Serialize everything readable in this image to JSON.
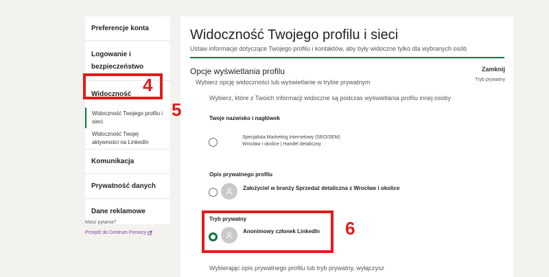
{
  "sidebar": {
    "items": [
      {
        "label": "Preferencje konta"
      },
      {
        "label": "Logowanie i bezpieczeństwo"
      },
      {
        "label": "Widoczność"
      },
      {
        "label": "Widoczność Twojego profilu i sieci"
      },
      {
        "label": "Widoczność Twojej aktywności na LinkedIn"
      },
      {
        "label": "Komunikacja"
      },
      {
        "label": "Prywatność danych"
      },
      {
        "label": "Dane reklamowe"
      }
    ],
    "help_question": "Masz pytania?",
    "help_link": "Przejdź do Centrum Pomocy",
    "help_link_icon": "external-link-icon"
  },
  "main": {
    "title": "Widoczność Twojego profilu i sieci",
    "subtitle": "Ustaw informacje dotyczące Twojego profilu i kontaktów, aby były widoczne tylko dla wybranych osób",
    "section_title": "Opcje wyświetlania profilu",
    "section_subtitle": "Wybierz opcję widoczności lub wyświetlanie w trybie prywatnym",
    "close_label": "Zamknij",
    "current_mode": "Tryb prywatny",
    "intro": "Wybierz, które z Twoich informacji widoczne są podczas wyświetlania profilu innej osoby",
    "options": [
      {
        "title": "Twoje nazwisko i nagłówek",
        "line1": "Specjalista Marketing internetowy (SEO/SEM)",
        "line2": "Wrocław i okolice | Handel detaliczny",
        "selected": false
      },
      {
        "title": "Opis prywatnego profilu",
        "text": "Założyciel w branży Sprzedaż detaliczna z Wrocław i okolice",
        "selected": false
      },
      {
        "title": "Tryb prywatny",
        "text": "Anonimowy członek LinkedIn",
        "selected": true
      }
    ],
    "bottom_text": "Wybierając opis prywatnego profilu lub tryb prywatny, wyłączysz"
  },
  "annotations": {
    "n4": "4",
    "n5": "5",
    "n6": "6",
    "color": "#e21b1b"
  },
  "colors": {
    "accent": "#057642",
    "link": "#7a3e9d",
    "background": "#f3f2ef"
  }
}
